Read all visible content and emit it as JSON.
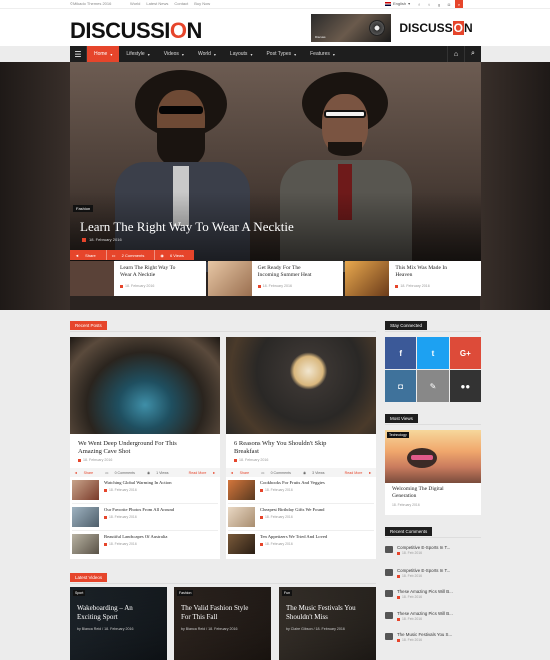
{
  "topbar": {
    "copyright": "©Mikado Themes 2016",
    "links": [
      "World",
      "Latest News",
      "Contact",
      "Buy Now"
    ],
    "language": "English"
  },
  "logo": {
    "prefix": "DISCUSSI",
    "o": "O",
    "suffix": "N"
  },
  "banner": {
    "prefix": "DISCUSS",
    "o": "O",
    "suffix": "N",
    "small": "Discuss"
  },
  "nav": {
    "items": [
      {
        "label": "Home",
        "active": true
      },
      {
        "label": "Lifestyle"
      },
      {
        "label": "Videos"
      },
      {
        "label": "World"
      },
      {
        "label": "Layouts"
      },
      {
        "label": "Post Types"
      },
      {
        "label": "Features"
      }
    ]
  },
  "hero": {
    "category": "Fashion",
    "title": "Learn The Right Way To Wear A Necktie",
    "date": "18. February 2016",
    "share": "Share",
    "comments": "2 Comments",
    "views": "6 Views",
    "cards": [
      {
        "title_line1": "Learn The Right Way To",
        "title_line2": "Wear A Necktie",
        "date": "18. February 2016",
        "thumb": "#5a4238"
      },
      {
        "title_line1": "Get Ready For The",
        "title_line2": "Incoming Summer Heat",
        "date": "18. February 2016",
        "thumb": "#c89a78"
      },
      {
        "title_line1": "This Mix Was Made In",
        "title_line2": "Heaven",
        "date": "18. February 2016",
        "thumb": "#b87a3a"
      }
    ]
  },
  "recent_posts": {
    "label": "Recent Posts",
    "columns": [
      {
        "title_line1": "We Went Deep Underground For This",
        "title_line2": "Amazing Cave Shot",
        "date": "18. February 2016",
        "share": "Share",
        "comments": "0 Comments",
        "views": "1 Views",
        "read_more": "Read More",
        "list": [
          {
            "title": "Watching Global Warming In Action",
            "date": "18. February 2016"
          },
          {
            "title": "Our Favorite Photos From All Around",
            "date": "18. February 2016"
          },
          {
            "title": "Beautiful Landscapes Of Australia",
            "date": "18. February 2016"
          }
        ]
      },
      {
        "title_line1": "6 Reasons Why You Shouldn't Skip",
        "title_line2": "Breakfast",
        "date": "18. February 2016",
        "share": "Share",
        "comments": "0 Comments",
        "views": "3 Views",
        "read_more": "Read More",
        "list": [
          {
            "title": "Cookbooks For Fruits And Veggies",
            "date": "18. February 2016"
          },
          {
            "title": "Cheapest Birthday Gifts We Found",
            "date": "18. February 2016"
          },
          {
            "title": "Ten Appetizers We Tried And Loved",
            "date": "18. February 2016"
          }
        ]
      }
    ]
  },
  "sidebar": {
    "stay_connected": "Stay Connected",
    "social_tiles": [
      {
        "glyph": "f",
        "color": "#3b5998"
      },
      {
        "glyph": "t",
        "color": "#1da1f2"
      },
      {
        "glyph": "G+",
        "color": "#dd4b39"
      },
      {
        "glyph": "◘",
        "color": "#3f729b"
      },
      {
        "glyph": "✎",
        "color": "#888888"
      },
      {
        "glyph": "●●",
        "color": "#333333"
      }
    ],
    "most_views": "Most Views",
    "most_view_post": {
      "category": "Technology",
      "title_line1": "Welcoming The Digital",
      "title_line2": "Generation",
      "date": "18. February 2016"
    },
    "recent_comments": "Recent Comments",
    "comments": [
      {
        "title": "Competitive E-Sports In T...",
        "date": "18. Feb 2016"
      },
      {
        "title": "Competitive E-Sports In T...",
        "date": "18. Feb 2016"
      },
      {
        "title": "These Amazing Pics Will B...",
        "date": "18. Feb 2016"
      },
      {
        "title": "These Amazing Pics Will B...",
        "date": "18. Feb 2016"
      },
      {
        "title": "The Music Festivals You S...",
        "date": "18. Feb 2016"
      }
    ]
  },
  "latest_videos": {
    "label": "Latest Videos",
    "items": [
      {
        "category": "Sport",
        "title_line1": "Wakeboarding – An",
        "title_line2": "Exciting Sport",
        "byline": "by Bianca Reid / 18. February 2016"
      },
      {
        "category": "Fashion",
        "title_line1": "The Valid Fashion Style",
        "title_line2": "For This Fall",
        "byline": "by Bianca Reid / 18. February 2016"
      },
      {
        "category": "Fun",
        "title_line1": "The Music Festivals You",
        "title_line2": "Shouldn't Miss",
        "byline": "by Claire Gibson / 18. February 2016"
      }
    ]
  },
  "colors": {
    "accent": "#e6452b",
    "dark": "#1e1e1e",
    "page_bg": "#ececec"
  }
}
